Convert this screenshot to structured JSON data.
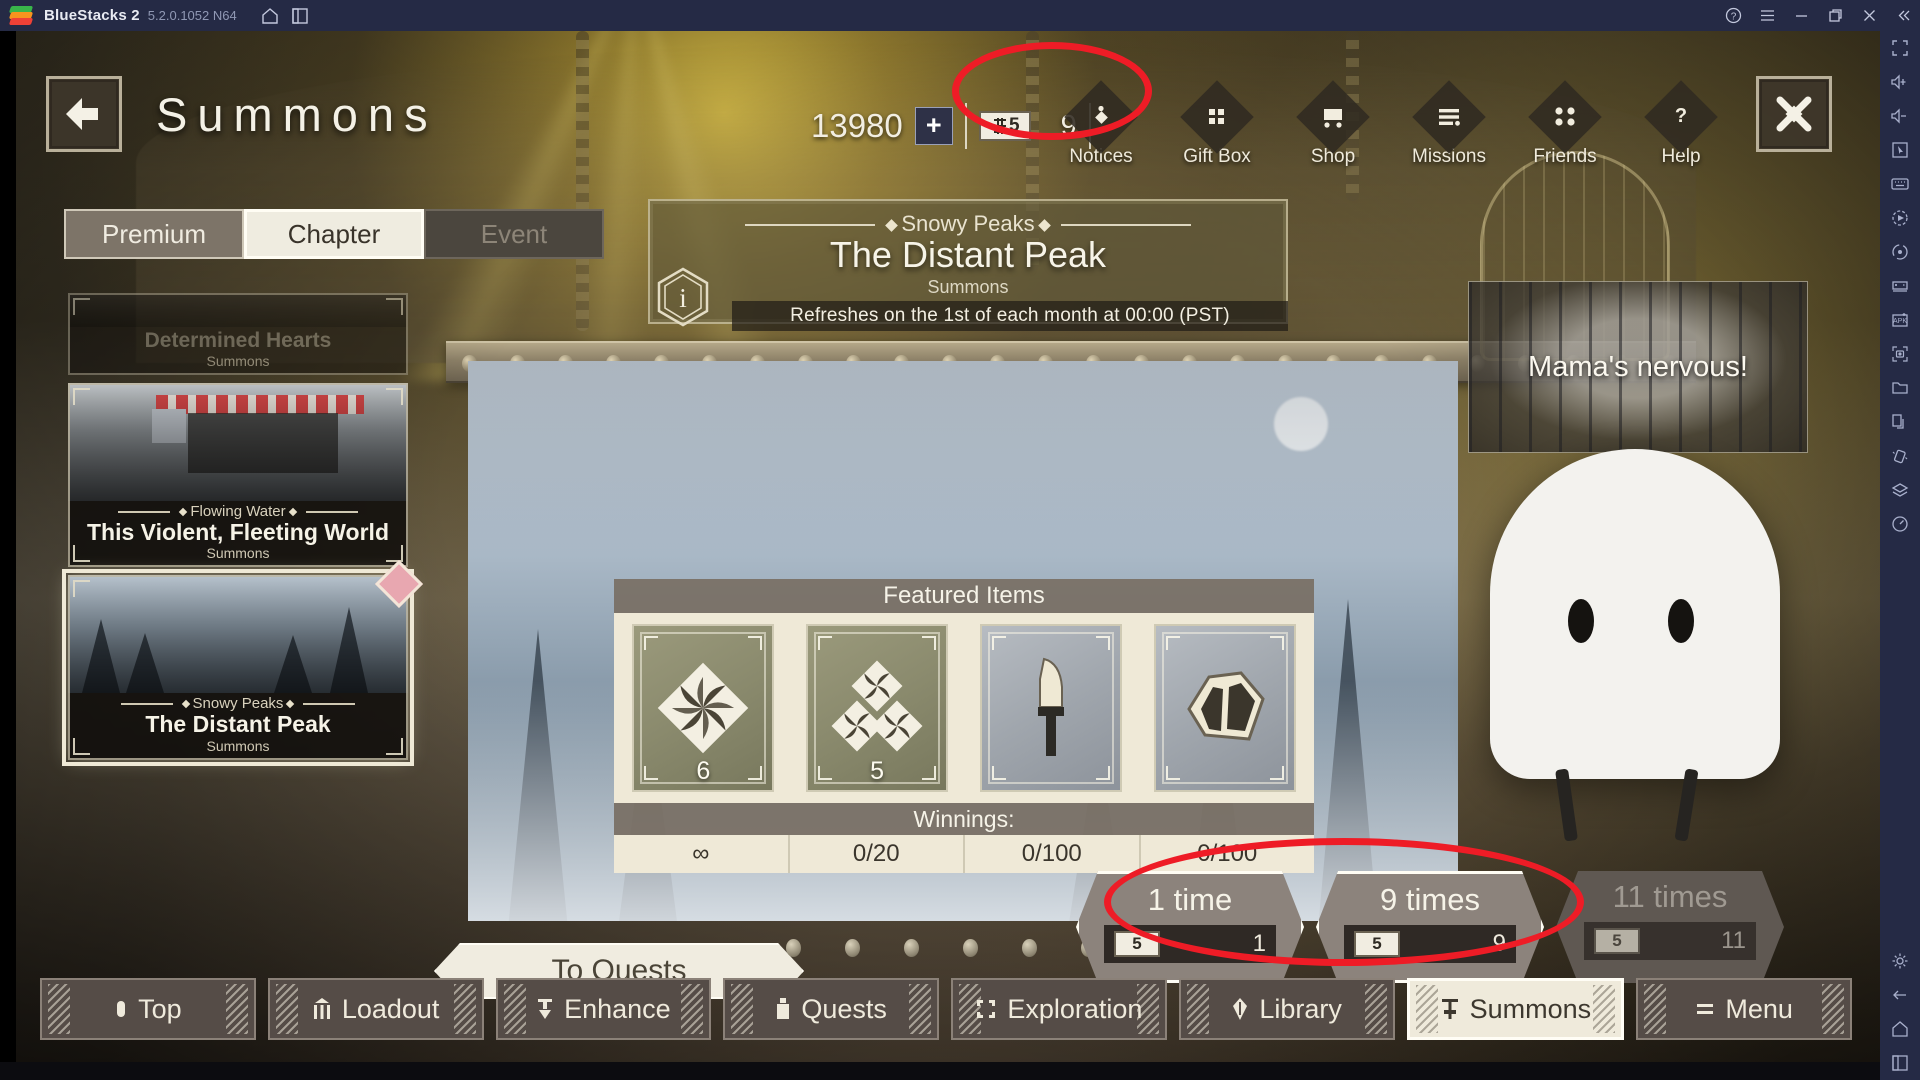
{
  "emulator": {
    "app_name": "BlueStacks 2",
    "version": "5.2.0.1052 N64",
    "titlebar_icons": [
      "home-icon",
      "multi-instance-icon"
    ],
    "window_buttons": [
      "help-icon",
      "hamburger-menu-icon",
      "minimize-icon",
      "restore-icon",
      "close-icon",
      "collapse-icon"
    ],
    "sidebar_icons": [
      "fullscreen-icon",
      "volume-up-icon",
      "volume-down-icon",
      "cursor-icon",
      "keyboard-icon",
      "record-macro-icon",
      "rotate-icon",
      "game-controls-icon",
      "install-apk-icon",
      "screenshot-icon",
      "media-folder-icon",
      "multi-instance-icon",
      "shake-icon",
      "layers-icon",
      "performance-icon"
    ],
    "sidebar_bottom_icons": [
      "settings-gear-icon",
      "back-arrow-icon",
      "home-icon",
      "recent-apps-icon"
    ]
  },
  "header": {
    "back_icon": "back-arrow-icon",
    "title": "Summons",
    "close_icon": "close-x-icon",
    "currency": {
      "amount": "13980",
      "plus_label": "+",
      "ticket_label": "5",
      "ticket_count": "9"
    },
    "nav": [
      {
        "label": "Notices",
        "icon": "notices-diamond-icon"
      },
      {
        "label": "Gift Box",
        "icon": "gift-box-icon"
      },
      {
        "label": "Shop",
        "icon": "shop-icon"
      },
      {
        "label": "Missions",
        "icon": "missions-icon"
      },
      {
        "label": "Friends",
        "icon": "friends-icon"
      },
      {
        "label": "Help",
        "icon": "help-question-icon"
      }
    ]
  },
  "tabs": [
    {
      "label": "Premium",
      "state": "normal"
    },
    {
      "label": "Chapter",
      "state": "selected"
    },
    {
      "label": "Event",
      "state": "disabled"
    }
  ],
  "banner_header": {
    "chapter": "Snowy Peaks",
    "title": "The Distant Peak",
    "kind": "Summons",
    "refresh_note": "Refreshes on the 1st of each month at 00:00 (PST)",
    "info_icon": "info-hex-icon"
  },
  "banner_list": [
    {
      "chapter": "",
      "title": "Determined Hearts",
      "kind": "Summons",
      "state": "dimmed"
    },
    {
      "chapter": "Flowing Water",
      "title": "This Violent, Fleeting World",
      "kind": "Summons",
      "state": "normal"
    },
    {
      "chapter": "Snowy Peaks",
      "title": "The Distant Peak",
      "kind": "Summons",
      "state": "selected",
      "badge": "new-diamond-badge"
    }
  ],
  "featured": {
    "heading": "Featured Items",
    "winnings_label": "Winnings:",
    "items": [
      {
        "icon": "pinwheel-single-icon",
        "qty": "6",
        "rarity": "olive",
        "winnings": "∞"
      },
      {
        "icon": "pinwheel-triple-icon",
        "qty": "5",
        "rarity": "olive",
        "winnings": "0/20"
      },
      {
        "icon": "brush-icon",
        "qty": "",
        "rarity": "steel",
        "winnings": "0/100"
      },
      {
        "icon": "stone-fragment-icon",
        "qty": "",
        "rarity": "steel",
        "winnings": "0/100"
      }
    ]
  },
  "dialogue": {
    "text": "Mama's nervous!"
  },
  "to_quests": {
    "label": "To Quests"
  },
  "summon_buttons": [
    {
      "label": "1 time",
      "ticket": "5",
      "cost": "1",
      "state": "enabled"
    },
    {
      "label": "9 times",
      "ticket": "5",
      "cost": "9",
      "state": "enabled"
    },
    {
      "label": "11 times",
      "ticket": "5",
      "cost": "11",
      "state": "disabled"
    }
  ],
  "bottom_nav": [
    {
      "label": "Top",
      "icon": "top-icon",
      "state": "normal"
    },
    {
      "label": "Loadout",
      "icon": "loadout-icon",
      "state": "normal"
    },
    {
      "label": "Enhance",
      "icon": "enhance-icon",
      "state": "normal"
    },
    {
      "label": "Quests",
      "icon": "quests-icon",
      "state": "normal"
    },
    {
      "label": "Exploration",
      "icon": "exploration-icon",
      "state": "normal"
    },
    {
      "label": "Library",
      "icon": "library-icon",
      "state": "normal"
    },
    {
      "label": "Summons",
      "icon": "summons-icon",
      "state": "active"
    },
    {
      "label": "Menu",
      "icon": "menu-icon",
      "state": "normal"
    }
  ],
  "annotations": {
    "color": "#ee1c26",
    "marks": [
      "ticket-currency-highlight",
      "summon-buttons-highlight"
    ]
  }
}
